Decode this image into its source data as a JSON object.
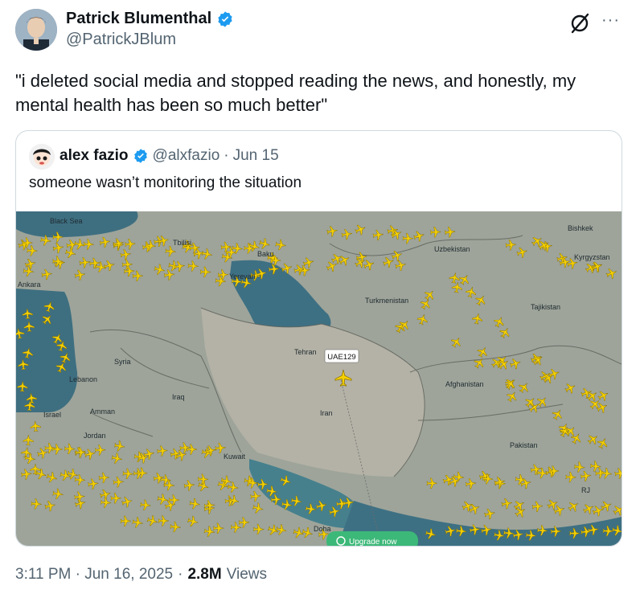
{
  "tweet": {
    "author": {
      "display_name": "Patrick Blumenthal",
      "handle": "@PatrickJBlum"
    },
    "text": "\"i deleted social media and stopped reading the news, and honestly, my mental health has been so much better\"",
    "timestamp": "3:11 PM · Jun 16, 2025",
    "separator": "·",
    "views_count": "2.8M",
    "views_label": "Views",
    "icons": {
      "verified": "verified-badge-icon",
      "grok": "grok-icon",
      "more": "more-icon"
    }
  },
  "quote": {
    "author": {
      "display_name": "alex fazio",
      "handle": "@alxfazio"
    },
    "separator": "·",
    "date": "Jun 15",
    "text": "someone wasn’t monitoring the situation",
    "map": {
      "labels": [
        "Black Sea",
        "Tbilisi",
        "Yerevan",
        "Baku",
        "Ankara",
        "Syria",
        "Lebanon",
        "Israel",
        "Amman",
        "Jordan",
        "Iraq",
        "Kuwait",
        "Tehran",
        "Iran",
        "Turkmenistan",
        "Uzbekistan",
        "Kyrgyzstan",
        "Bishkek",
        "Tajikistan",
        "Afghanistan",
        "Pakistan",
        "RJ",
        "Doha"
      ],
      "flight_tag": "UAE129",
      "upgrade_button": "Upgrade now"
    }
  },
  "colors": {
    "link_blue": "#1d9bf0",
    "plane_yellow": "#f5d000",
    "flight_red": "#e53935"
  }
}
